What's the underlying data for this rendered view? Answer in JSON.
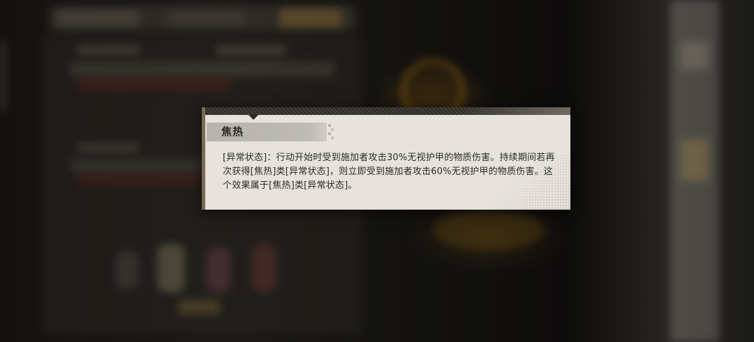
{
  "tooltip": {
    "title": "焦热",
    "description": "[异常状态]：行动开始时受到施加者攻击30%无视护甲的物质伤害。持续期间若再次获得[焦热]类[异常状态]，则立即受到施加者攻击60%无视护甲的物质伤害。这个效果属于[焦热]类[异常状态]。"
  },
  "colors": {
    "tooltip_background": "#e7e2dc",
    "title_bar": "#b8b3ad",
    "accent_bar": "#7b6a55",
    "top_band": "#2c2926"
  }
}
